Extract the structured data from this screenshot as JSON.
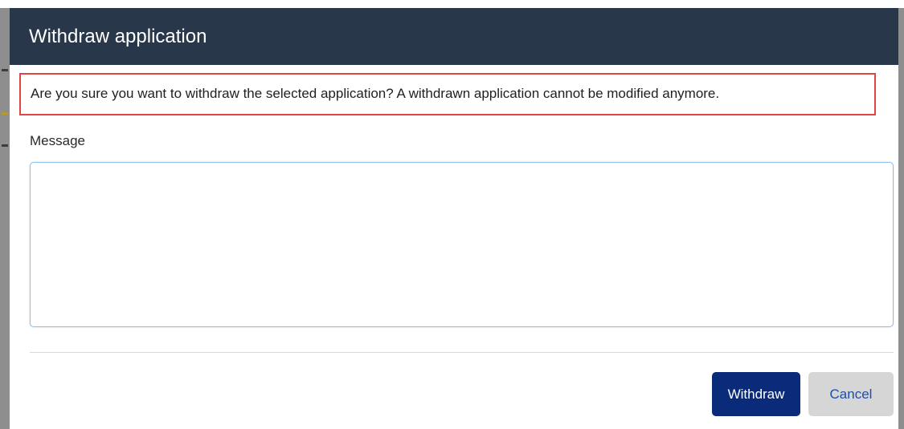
{
  "dialog": {
    "title": "Withdraw application",
    "confirmation_text": "Are you sure you want to withdraw the selected application? A withdrawn application cannot be modified anymore.",
    "message_label": "Message",
    "message_value": "",
    "message_placeholder": ""
  },
  "actions": {
    "withdraw_label": "Withdraw",
    "cancel_label": "Cancel"
  },
  "colors": {
    "header_bg": "#29374a",
    "highlight_border": "#e04545",
    "primary_button": "#0a2a7a",
    "secondary_button": "#d6d6d6",
    "secondary_button_text": "#1e4ea8"
  }
}
